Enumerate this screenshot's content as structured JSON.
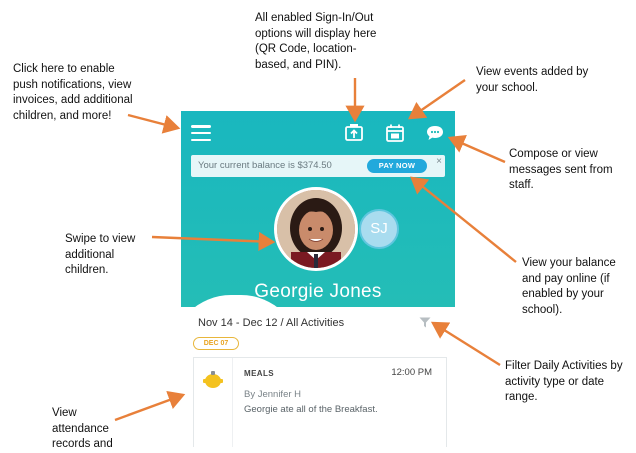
{
  "annotations": {
    "menu": [
      "Click here to enable",
      "push notifications, view",
      "invoices, add additional",
      "children, and more!"
    ],
    "signin": [
      "All enabled Sign-In/Out",
      "options will display here",
      "(QR Code, location-",
      "based, and PIN)."
    ],
    "events": [
      "View events added by",
      "your school."
    ],
    "messages": [
      "Compose or view",
      "messages sent from",
      "staff."
    ],
    "swipe": [
      "Swipe to view",
      "additional",
      "children."
    ],
    "balance": [
      "View your balance",
      "and pay online (if",
      "enabled by your",
      "school)."
    ],
    "filter": [
      "Filter Daily Activities by",
      "activity type or date",
      "range."
    ],
    "attendance": [
      "View",
      "attendance",
      "records and"
    ]
  },
  "app": {
    "balance_text": "Your current balance is $374.50",
    "pay_label": "PAY NOW",
    "close_label": "×",
    "secondary_initials": "SJ",
    "child_name": "Georgie Jones",
    "date_range": "Nov 14 - Dec 12 / All Activities",
    "date_badge": "DEC 07",
    "activity": {
      "type": "MEALS",
      "time": "12:00 PM",
      "by": "By Jennifer H",
      "description": "Georgie ate all of the Breakfast."
    }
  },
  "colors": {
    "teal_top": "#19b7bf",
    "teal_bottom": "#2cc2b0",
    "pay_button": "#22a9dc",
    "arrow": "#e8803a",
    "date_badge": "#e8b63b"
  },
  "icons": [
    "menu-icon",
    "sign-in-icon",
    "calendar-icon",
    "chat-icon",
    "filter-icon",
    "meal-icon"
  ]
}
